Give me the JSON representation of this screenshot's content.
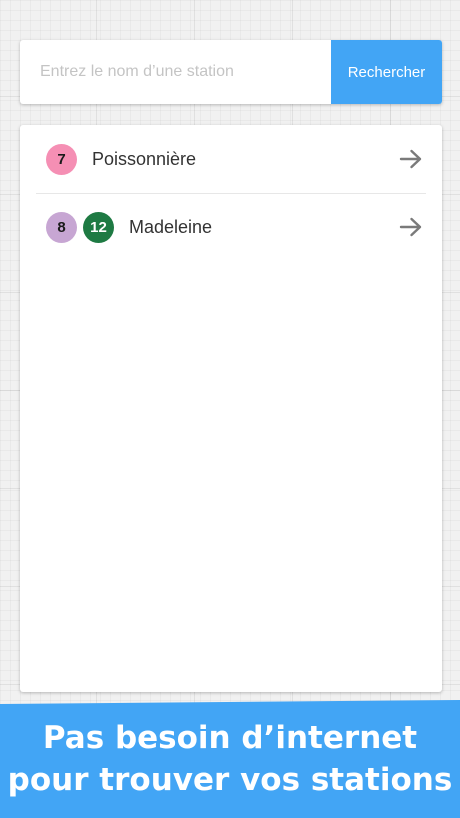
{
  "search": {
    "placeholder": "Entrez le nom d’une station",
    "value": "",
    "button_label": "Rechercher"
  },
  "stations": [
    {
      "name": "Poissonnière",
      "lines": [
        {
          "number": "7",
          "color": "#f58fb4",
          "text_color": "#1a1a1a"
        }
      ]
    },
    {
      "name": "Madeleine",
      "lines": [
        {
          "number": "8",
          "color": "#c7a6d3",
          "text_color": "#1a1a1a"
        },
        {
          "number": "12",
          "color": "#1e7a43",
          "text_color": "#ffffff"
        }
      ]
    }
  ],
  "icons": {
    "row_action": "arrow-right-icon"
  },
  "banner": {
    "line1": "Pas besoin d’internet",
    "line2": "pour trouver vos stations"
  },
  "colors": {
    "accent": "#42a5f5",
    "arrow": "#7a7a7a"
  }
}
